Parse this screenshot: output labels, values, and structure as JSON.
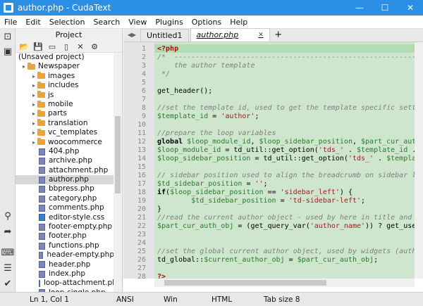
{
  "window": {
    "title": "author.php - CudaText",
    "minimize": "—",
    "maximize": "☐",
    "close": "✕"
  },
  "menu": [
    "File",
    "Edit",
    "Selection",
    "Search",
    "View",
    "Plugins",
    "Options",
    "Help"
  ],
  "project": {
    "header": "Project",
    "toolbar_icons": [
      "open-folder-icon",
      "save-icon",
      "folder-add-icon",
      "file-add-icon",
      "remove-icon",
      "gear-icon"
    ],
    "tree": [
      {
        "label": "(Unsaved project)",
        "type": "root",
        "indent": 0
      },
      {
        "label": "Newspaper",
        "type": "folder",
        "indent": 1
      },
      {
        "label": "images",
        "type": "folder",
        "indent": 2
      },
      {
        "label": "includes",
        "type": "folder",
        "indent": 2
      },
      {
        "label": "js",
        "type": "folder",
        "indent": 2
      },
      {
        "label": "mobile",
        "type": "folder",
        "indent": 2
      },
      {
        "label": "parts",
        "type": "folder",
        "indent": 2
      },
      {
        "label": "translation",
        "type": "folder",
        "indent": 2
      },
      {
        "label": "vc_templates",
        "type": "folder",
        "indent": 2
      },
      {
        "label": "woocommerce",
        "type": "folder",
        "indent": 2
      },
      {
        "label": "404.php",
        "type": "php",
        "indent": 2
      },
      {
        "label": "archive.php",
        "type": "php",
        "indent": 2
      },
      {
        "label": "attachment.php",
        "type": "php",
        "indent": 2
      },
      {
        "label": "author.php",
        "type": "php",
        "indent": 2,
        "selected": true
      },
      {
        "label": "bbpress.php",
        "type": "php",
        "indent": 2
      },
      {
        "label": "category.php",
        "type": "php",
        "indent": 2
      },
      {
        "label": "comments.php",
        "type": "php",
        "indent": 2
      },
      {
        "label": "editor-style.css",
        "type": "css",
        "indent": 2
      },
      {
        "label": "footer-empty.php",
        "type": "php",
        "indent": 2
      },
      {
        "label": "footer.php",
        "type": "php",
        "indent": 2
      },
      {
        "label": "functions.php",
        "type": "php",
        "indent": 2
      },
      {
        "label": "header-empty.php",
        "type": "php",
        "indent": 2
      },
      {
        "label": "header.php",
        "type": "php",
        "indent": 2
      },
      {
        "label": "index.php",
        "type": "php",
        "indent": 2
      },
      {
        "label": "loop-attachment.php",
        "type": "php",
        "indent": 2
      },
      {
        "label": "loop-single.php",
        "type": "php",
        "indent": 2
      }
    ]
  },
  "tabs": [
    {
      "label": "Untitled1",
      "active": false
    },
    {
      "label": "author.php",
      "active": true
    }
  ],
  "code_lines": [
    {
      "n": "1",
      "html": "<span class='c-tag'>&lt;?php</span>"
    },
    {
      "n": "2",
      "html": "<span class='c-cmt'>/*  ----------------------------------------------------------------</span>"
    },
    {
      "n": "3",
      "html": "<span class='c-cmt'>    the author template</span>"
    },
    {
      "n": "4",
      "html": "<span class='c-cmt'> */</span>"
    },
    {
      "n": "5",
      "html": ""
    },
    {
      "n": "6",
      "html": "get_header();"
    },
    {
      "n": "7",
      "html": ""
    },
    {
      "n": "8",
      "html": "<span class='c-cmt'>//set the template id, used to get the template specific settings</span>"
    },
    {
      "n": "9",
      "html": "<span class='c-var'>$template_id</span> = <span class='c-str'>'author'</span>;"
    },
    {
      "n": "10",
      "html": ""
    },
    {
      "n": "11",
      "html": "<span class='c-cmt'>//prepare the loop variables</span>"
    },
    {
      "n": "12",
      "html": "<span class='c-kw'>global</span> <span class='c-var'>$loop_module_id</span>, <span class='c-var'>$loop_sidebar_position</span>, <span class='c-var'>$part_cur_auth_obj</span>;"
    },
    {
      "n": "13",
      "html": "<span class='c-var'>$loop_module_id</span> = td_util::get_option(<span class='c-str'>'tds_'</span> . <span class='c-var'>$template_id</span> . <span class='c-str'>'_page_l</span>"
    },
    {
      "n": "14",
      "html": "<span class='c-var'>$loop_sidebar_position</span> = td_util::get_option(<span class='c-str'>'tds_'</span> . <span class='c-var'>$template_id</span> . <span class='c-str'>'</span>"
    },
    {
      "n": "15",
      "html": ""
    },
    {
      "n": "16",
      "html": "<span class='c-cmt'>// sidebar position used to align the breadcrumb on sidebar left + sid</span>"
    },
    {
      "n": "17",
      "html": "<span class='c-var'>$td_sidebar_position</span> = <span class='c-str'>''</span>;"
    },
    {
      "n": "18",
      "html": "<span class='c-kw'>if</span>(<span class='c-var'>$loop_sidebar_position</span> == <span class='c-str'>'sidebar_left'</span>) {"
    },
    {
      "n": "19",
      "html": "        <span class='c-var'>$td_sidebar_position</span> = <span class='c-str'>'td-sidebar-left'</span>;"
    },
    {
      "n": "20",
      "html": "}"
    },
    {
      "n": "21",
      "html": "<span class='c-cmt'>//read the current author object - used by here in title and by /parts</span>"
    },
    {
      "n": "22",
      "html": "<span class='c-var'>$part_cur_auth_obj</span> = (get_query_var(<span class='c-str'>'author_name'</span>)) ? get_user_by(<span class='c-str'>'slu</span>"
    },
    {
      "n": "23",
      "html": ""
    },
    {
      "n": "24",
      "html": ""
    },
    {
      "n": "25",
      "html": "<span class='c-cmt'>//set the global current author object, used by widgets (author widget</span>"
    },
    {
      "n": "26",
      "html": "td_global::<span class='c-var'>$current_author_obj</span> = <span class='c-var'>$part_cur_auth_obj</span>;"
    },
    {
      "n": "27",
      "html": ""
    },
    {
      "n": "28",
      "html": "<span class='c-tag'>?&gt;</span>"
    }
  ],
  "status": {
    "position": "Ln 1, Col 1",
    "encoding": "ANSI",
    "line_ending": "Win",
    "lexer": "HTML",
    "tab_size": "Tab size 8"
  }
}
